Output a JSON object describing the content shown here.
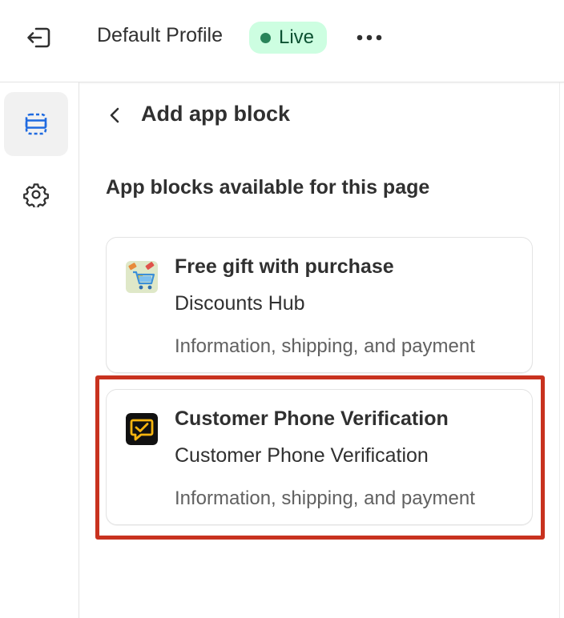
{
  "header": {
    "profile_name": "Default Profile",
    "status": "Live"
  },
  "sidebar": {
    "items": [
      {
        "name": "sections",
        "icon": "layout-sections-icon",
        "active": true
      },
      {
        "name": "settings",
        "icon": "gear-icon",
        "active": false
      }
    ]
  },
  "panel": {
    "title": "Add app block",
    "section_heading": "App blocks available for this page",
    "blocks": [
      {
        "title": "Free gift with purchase",
        "app": "Discounts Hub",
        "target": "Information, shipping, and payment",
        "icon": "gift-cart-icon"
      },
      {
        "title": "Customer Phone Verification",
        "app": "Customer Phone Verification",
        "target": "Information, shipping, and payment",
        "icon": "chat-check-icon",
        "highlighted": true
      }
    ]
  },
  "colors": {
    "live_badge_bg": "#cdfee1",
    "live_dot": "#29845a",
    "highlight": "#c8321f",
    "icon_accent": "#1f6ae0"
  }
}
